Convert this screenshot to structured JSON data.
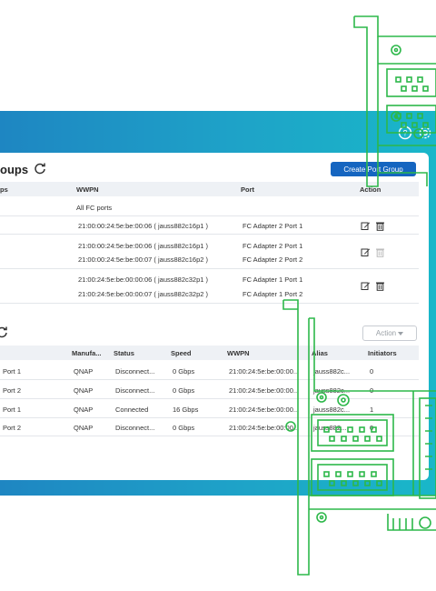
{
  "page": {
    "accent": "#1565c0",
    "band_gradient": [
      "#1e86c2",
      "#19b7c9"
    ],
    "overlay_color": "#2db84a"
  },
  "header_icons": [
    "help-icon",
    "settings-gear-icon"
  ],
  "port_groups": {
    "title": "oups",
    "create_button": "Create Port Group",
    "columns": {
      "name": "ps",
      "wwpn": "WWPN",
      "port": "Port",
      "action": "Action"
    },
    "rows": [
      {
        "wwpns": [
          "All FC ports"
        ],
        "ports": [],
        "actions": []
      },
      {
        "wwpns": [
          "21:00:00:24:5e:be:00:06 ( jauss882c16p1 )"
        ],
        "ports": [
          "FC Adapter 2 Port 1"
        ],
        "actions": [
          "edit",
          "delete"
        ]
      },
      {
        "wwpns": [
          "21:00:00:24:5e:be:00:06 ( jauss882c16p1 )",
          "21:00:00:24:5e:be:00:07 ( jauss882c16p2 )"
        ],
        "ports": [
          "FC Adapter 2 Port 1",
          "FC Adapter 2 Port 2"
        ],
        "actions": [
          "edit",
          "delete-disabled"
        ]
      },
      {
        "wwpns": [
          "21:00:24:5e:be:00:00:06 ( jauss882c32p1 )",
          "21:00:24:5e:be:00:00:07 ( jauss882c32p2 )"
        ],
        "ports": [
          "FC Adapter 1 Port 1",
          "FC Adapter 1 Port 2"
        ],
        "actions": [
          "edit",
          "delete"
        ]
      }
    ]
  },
  "fc_ports": {
    "action_button": "Action",
    "columns": {
      "manufacturer": "Manufa...",
      "status": "Status",
      "speed": "Speed",
      "wwpn": "WWPN",
      "alias": "Alias",
      "initiators": "Initiators"
    },
    "rows": [
      {
        "port": "Port 1",
        "manufacturer": "QNAP",
        "status": "Disconnect...",
        "speed": "0 Gbps",
        "wwpn": "21:00:24:5e:be:00:00...",
        "alias": "jauss882c...",
        "initiators": "0"
      },
      {
        "port": "Port 2",
        "manufacturer": "QNAP",
        "status": "Disconnect...",
        "speed": "0 Gbps",
        "wwpn": "21:00:24:5e:be:00:00...",
        "alias": "jauss882c...",
        "initiators": "0"
      },
      {
        "port": "Port 1",
        "manufacturer": "QNAP",
        "status": "Connected",
        "speed": "16 Gbps",
        "wwpn": "21:00:24:5e:be:00:00...",
        "alias": "jauss882c...",
        "initiators": "1"
      },
      {
        "port": "Port 2",
        "manufacturer": "QNAP",
        "status": "Disconnect...",
        "speed": "0 Gbps",
        "wwpn": "21:00:24:5e:be:00:00...",
        "alias": "jauss882...",
        "initiators": "0"
      }
    ]
  }
}
